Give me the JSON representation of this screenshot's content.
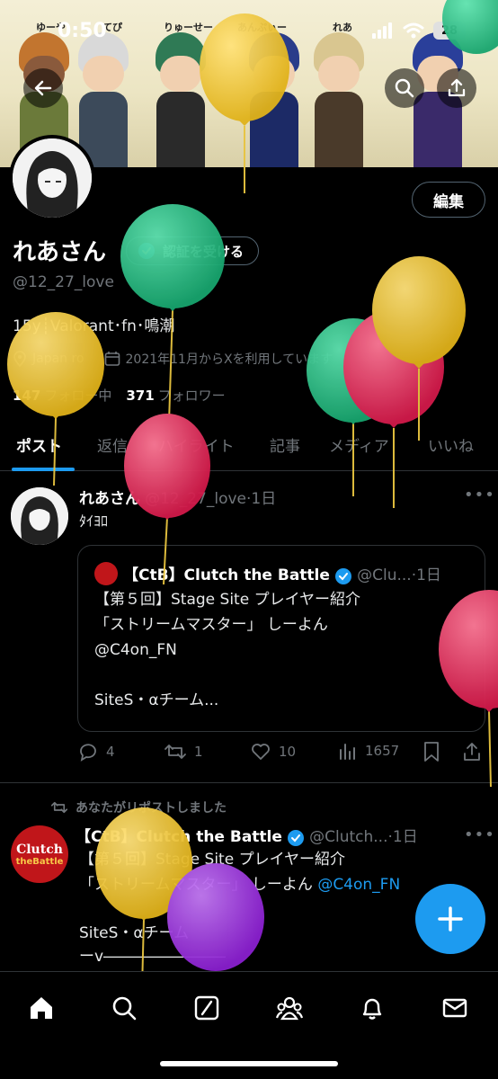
{
  "status_bar": {
    "time": "0:50",
    "battery": "28"
  },
  "banner": {
    "names": [
      "ゆーや",
      "てぴ",
      "りゅーせー",
      "あんぷぃー",
      "れあ"
    ]
  },
  "profile": {
    "edit_label": "編集",
    "display_name": "れあさん",
    "verify_label": "認証を受ける",
    "handle": "@12_27_love",
    "bio": "15y┊Valorant･fn･鳴潮",
    "location": "Japan ro",
    "joined": "2021年11月からXを利用しています",
    "following_count": "147",
    "following_label": "フォロー中",
    "followers_count": "371",
    "followers_label": "フォロワー"
  },
  "tabs": [
    "ポスト",
    "返信",
    "ハイライト",
    "記事",
    "メディア",
    "いいね"
  ],
  "tweet1": {
    "name": "れあさん",
    "handle": "@12_27_love",
    "time": "·1日",
    "text": "ﾀｲﾖﾛ",
    "quote": {
      "name": "【CtB】Clutch the Battle",
      "handle": "@Clu...",
      "time": "·1日",
      "text": "【第５回】Stage Site プレイヤー紹介\n「ストリームマスター」 しーよん\n@C4on_FN\n\nSiteS・αチーム..."
    },
    "replies": "4",
    "reposts": "1",
    "likes": "10",
    "views": "1657"
  },
  "tweet2": {
    "repost_label": "あなたがリポストしました",
    "name": "【CtB】Clutch the Battle",
    "handle": "@Clutch...",
    "time": "·1日",
    "line1": "【第５回】Stage Site プレイヤー紹介",
    "line2_prefix": "「ストリームマスター」 しーよん",
    "mention": "@C4on_FN",
    "line3": "SiteS・αチーム",
    "line4": "ーv――――――――",
    "avatar_text_top": "Clutch",
    "avatar_text_bottom": "theBattle"
  },
  "colors": {
    "accent": "#1d9bf0",
    "background": "#000000",
    "text_dim": "#71767b",
    "divider": "#2f3336"
  },
  "icons": {
    "back": "arrow-left-icon",
    "search": "search-icon",
    "share": "share-icon",
    "nav": [
      "home-icon",
      "search-icon",
      "grok-icon",
      "communities-icon",
      "bell-icon",
      "mail-icon"
    ]
  }
}
